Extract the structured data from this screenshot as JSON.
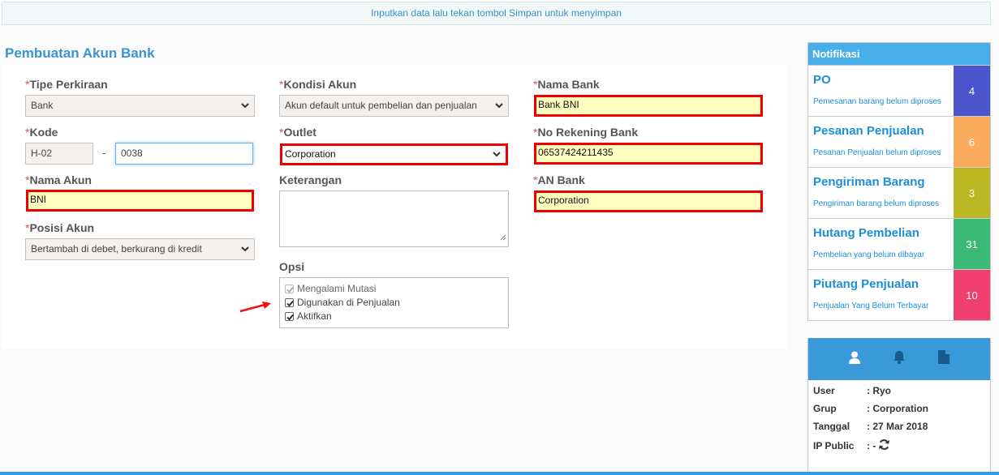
{
  "info_bar": "Inputkan data lalu tekan tombol Simpan untuk menyimpan",
  "page_title": "Pembuatan Akun Bank",
  "required_mark": "*",
  "form": {
    "tipe_perkiraan": {
      "label": "Tipe Perkiraan",
      "value": "Bank"
    },
    "kode": {
      "label": "Kode",
      "prefix": "H-02",
      "separator": "-",
      "value": "0038"
    },
    "nama_akun": {
      "label": "Nama Akun",
      "value": "BNI"
    },
    "posisi_akun": {
      "label": "Posisi Akun",
      "value": "Bertambah di debet, berkurang di kredit"
    },
    "kondisi_akun": {
      "label": "Kondisi Akun",
      "value": "Akun default untuk pembelian dan penjualan"
    },
    "outlet": {
      "label": "Outlet",
      "value": "Corporation"
    },
    "keterangan": {
      "label": "Keterangan",
      "value": ""
    },
    "opsi": {
      "label": "Opsi",
      "options": [
        {
          "label": "Mengalami Mutasi",
          "checked": true,
          "disabled": true
        },
        {
          "label": "Digunakan di Penjualan",
          "checked": true,
          "disabled": false
        },
        {
          "label": "Aktifkan",
          "checked": true,
          "disabled": false
        }
      ]
    },
    "nama_bank": {
      "label": "Nama Bank",
      "value": "Bank BNI"
    },
    "no_rekening": {
      "label": "No Rekening Bank",
      "value": "06537424211435"
    },
    "an_bank": {
      "label": "AN Bank",
      "value": "Corporation"
    }
  },
  "notifikasi": {
    "title": "Notifikasi",
    "items": [
      {
        "title": "PO",
        "desc": "Pemesanan barang belum diproses",
        "count": "4",
        "color": "#4a55cc"
      },
      {
        "title": "Pesanan Penjualan",
        "desc": "Pesanan Penjualan belum diproses",
        "count": "6",
        "color": "#fbad5d"
      },
      {
        "title": "Pengiriman Barang",
        "desc": "Pengiriman barang belum diproses",
        "count": "3",
        "color": "#bdb824"
      },
      {
        "title": "Hutang Pembelian",
        "desc": "Pembelian yang belum dibayar",
        "count": "31",
        "color": "#3bb977"
      },
      {
        "title": "Piutang Penjualan",
        "desc": "Penjualan Yang Belum Terbayar",
        "count": "10",
        "color": "#f03e6e"
      }
    ]
  },
  "user_info": {
    "tabs": [
      "user-icon",
      "bell-icon",
      "file-icon"
    ],
    "rows": [
      {
        "key": "User",
        "value": ": Ryo"
      },
      {
        "key": "Grup",
        "value": ": Corporation"
      },
      {
        "key": "Tanggal",
        "value": ": 27 Mar 2018"
      },
      {
        "key": "IP Public",
        "value": ": -"
      }
    ]
  }
}
